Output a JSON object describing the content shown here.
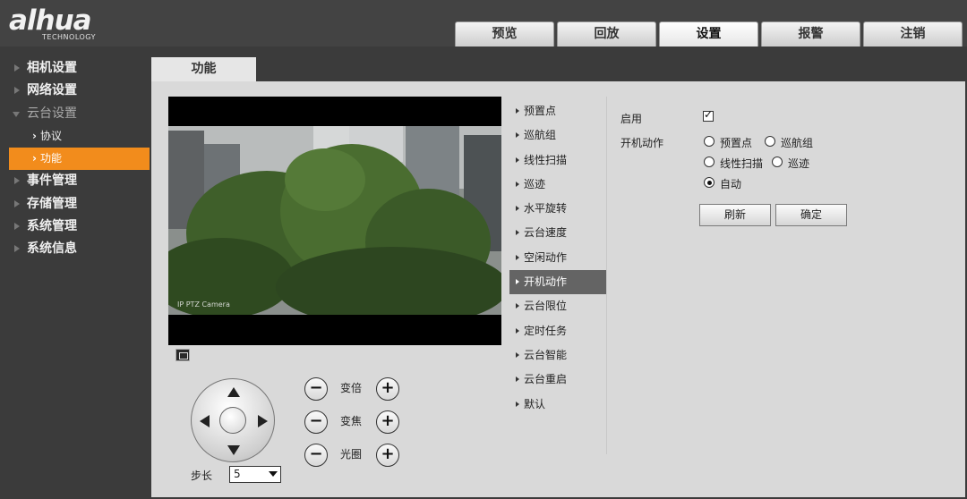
{
  "brand": {
    "logo": "alhua",
    "sub": "TECHNOLOGY"
  },
  "top_tabs": [
    {
      "label": "预览"
    },
    {
      "label": "回放"
    },
    {
      "label": "设置"
    },
    {
      "label": "报警"
    },
    {
      "label": "注销"
    }
  ],
  "sidebar": {
    "items": [
      {
        "label": "相机设置"
      },
      {
        "label": "网络设置"
      },
      {
        "label": "云台设置"
      },
      {
        "label": "系统管理"
      },
      {
        "label": "事件管理"
      },
      {
        "label": "存储管理"
      },
      {
        "label": "系统信息"
      }
    ],
    "sub_items": [
      {
        "label": "协议"
      },
      {
        "label": "功能"
      }
    ]
  },
  "page_tab": "功能",
  "video": {
    "camera_label": "IP PTZ Camera"
  },
  "ptz": {
    "step_label": "步长",
    "step_value": "5",
    "zoom_label": "变倍",
    "focus_label": "变焦",
    "iris_label": "光圈",
    "minus": "−",
    "plus": "+"
  },
  "menu": [
    {
      "label": "预置点"
    },
    {
      "label": "巡航组"
    },
    {
      "label": "线性扫描"
    },
    {
      "label": "巡迹"
    },
    {
      "label": "水平旋转"
    },
    {
      "label": "云台速度"
    },
    {
      "label": "空闲动作"
    },
    {
      "label": "开机动作"
    },
    {
      "label": "云台限位"
    },
    {
      "label": "定时任务"
    },
    {
      "label": "云台智能"
    },
    {
      "label": "云台重启"
    },
    {
      "label": "默认"
    }
  ],
  "form": {
    "enable_label": "启用",
    "enable_checked": true,
    "action_label": "开机动作",
    "options": [
      {
        "label": "预置点",
        "checked": false
      },
      {
        "label": "巡航组",
        "checked": false
      },
      {
        "label": "线性扫描",
        "checked": false
      },
      {
        "label": "巡迹",
        "checked": false
      },
      {
        "label": "自动",
        "checked": true
      }
    ],
    "refresh_button": "刷新",
    "confirm_button": "确定"
  },
  "colors": {
    "accent": "#f28c1c",
    "header": "#434343",
    "sidebar": "#3b3b3b",
    "content": "#d9d9d9"
  }
}
